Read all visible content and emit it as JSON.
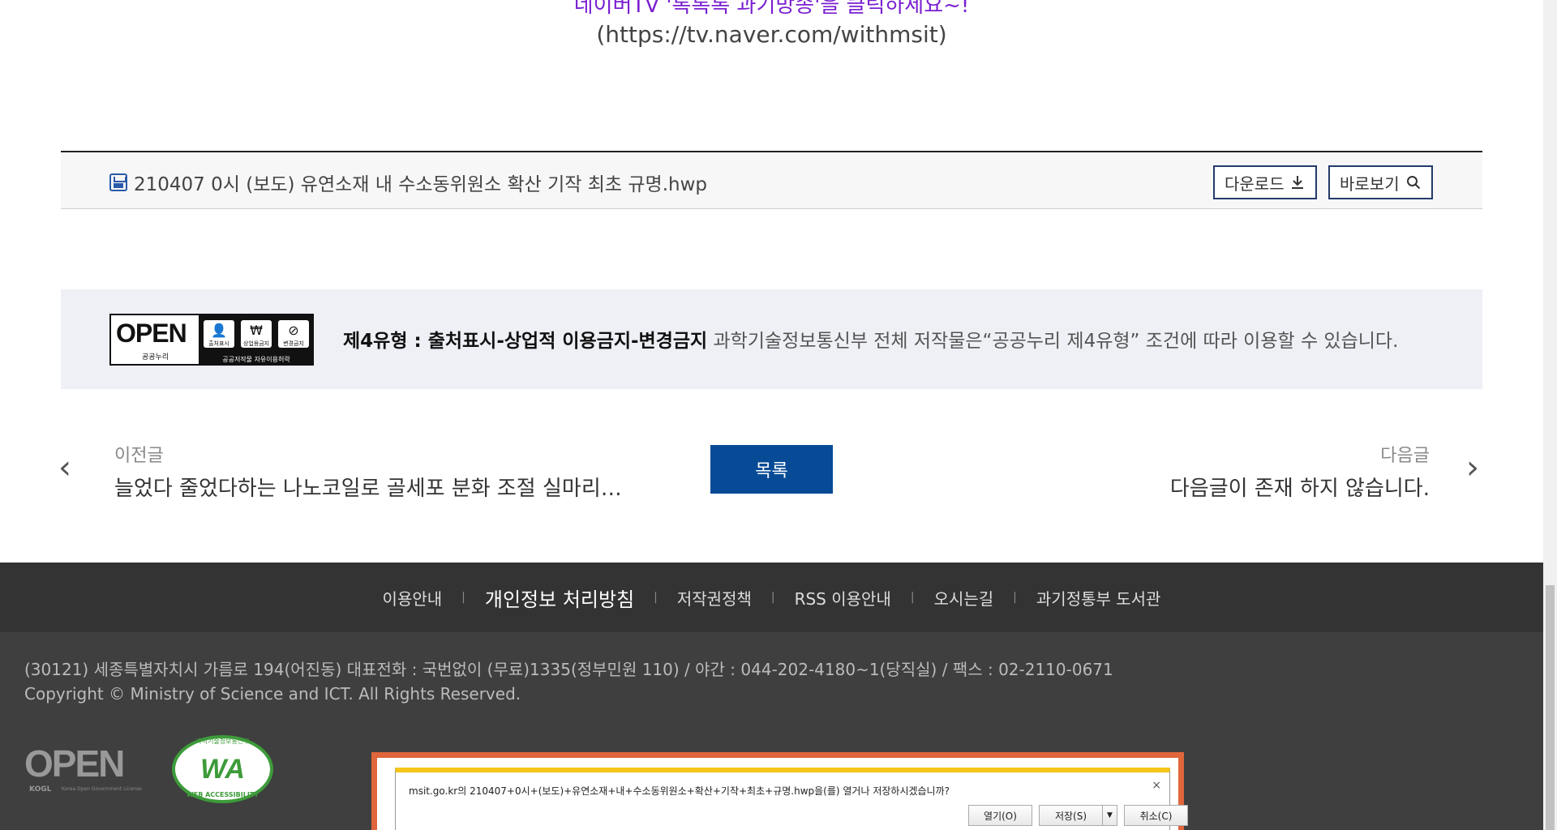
{
  "top": {
    "tv_line1": "네이버TV '톡톡톡 과기방송'을 클릭하세요~!",
    "tv_line2": "(https://tv.naver.com/withmsit)"
  },
  "attachment": {
    "file_name": "210407 0시 (보도) 유연소재 내 수소동위원소 확산 기작 최초 규명.hwp",
    "download_label": "다운로드",
    "preview_label": "바로보기"
  },
  "license": {
    "logo_word": "OPEN",
    "logo_sub": "공공누리",
    "icon_labels": [
      "출처표시",
      "상업용금지",
      "변경금지"
    ],
    "icon_caption": "공공저작물 자유이용허락",
    "type_title": "제4유형 : 출처표시-상업적 이용금지-변경금지",
    "description": " 과학기술정보통신부 전체 저작물은“공공누리 제4유형” 조건에 따라 이용할 수 있습니다."
  },
  "post_nav": {
    "prev_label": "이전글",
    "prev_title": "늘었다 줄었다하는 나노코일로 골세포 분화 조절 실마리…",
    "list_label": "목록",
    "next_label": "다음글",
    "next_title": "다음글이 존재 하지 않습니다."
  },
  "footer": {
    "links": [
      "이용안내",
      "개인정보 처리방침",
      "저작권정책",
      "RSS 이용안내",
      "오시는길",
      "과기정통부 도서관"
    ],
    "address": "(30121) 세종특별자치시 가름로 194(어진동) 대표전화 : 국번없이 (무료)1335(정부민원 110) / 야간 : 044-202-4180~1(당직실) / 팩스 : 02-2110-0671",
    "copyright": "Copyright © Ministry of Science and ICT. All Rights Reserved.",
    "open_logo_word": "OPEN",
    "open_logo_kogl": "KOGL",
    "open_logo_sub": "Korea Open Government License",
    "wa_logo_word": "WA",
    "wa_logo_top": "과학기술정보통신부",
    "wa_logo_bottom": "WEB ACCESSIBILITY"
  },
  "download_dialog": {
    "message": "msit.go.kr의 210407+0시+(보도)+유연소재+내+수소동위원소+확산+기작+최초+규명.hwp을(를) 열거나 저장하시겠습니까?",
    "open_label": "열기(O)",
    "save_label": "저장(S)",
    "cancel_label": "취소(C)",
    "close_glyph": "×",
    "highlight_color": "#e0663c"
  }
}
